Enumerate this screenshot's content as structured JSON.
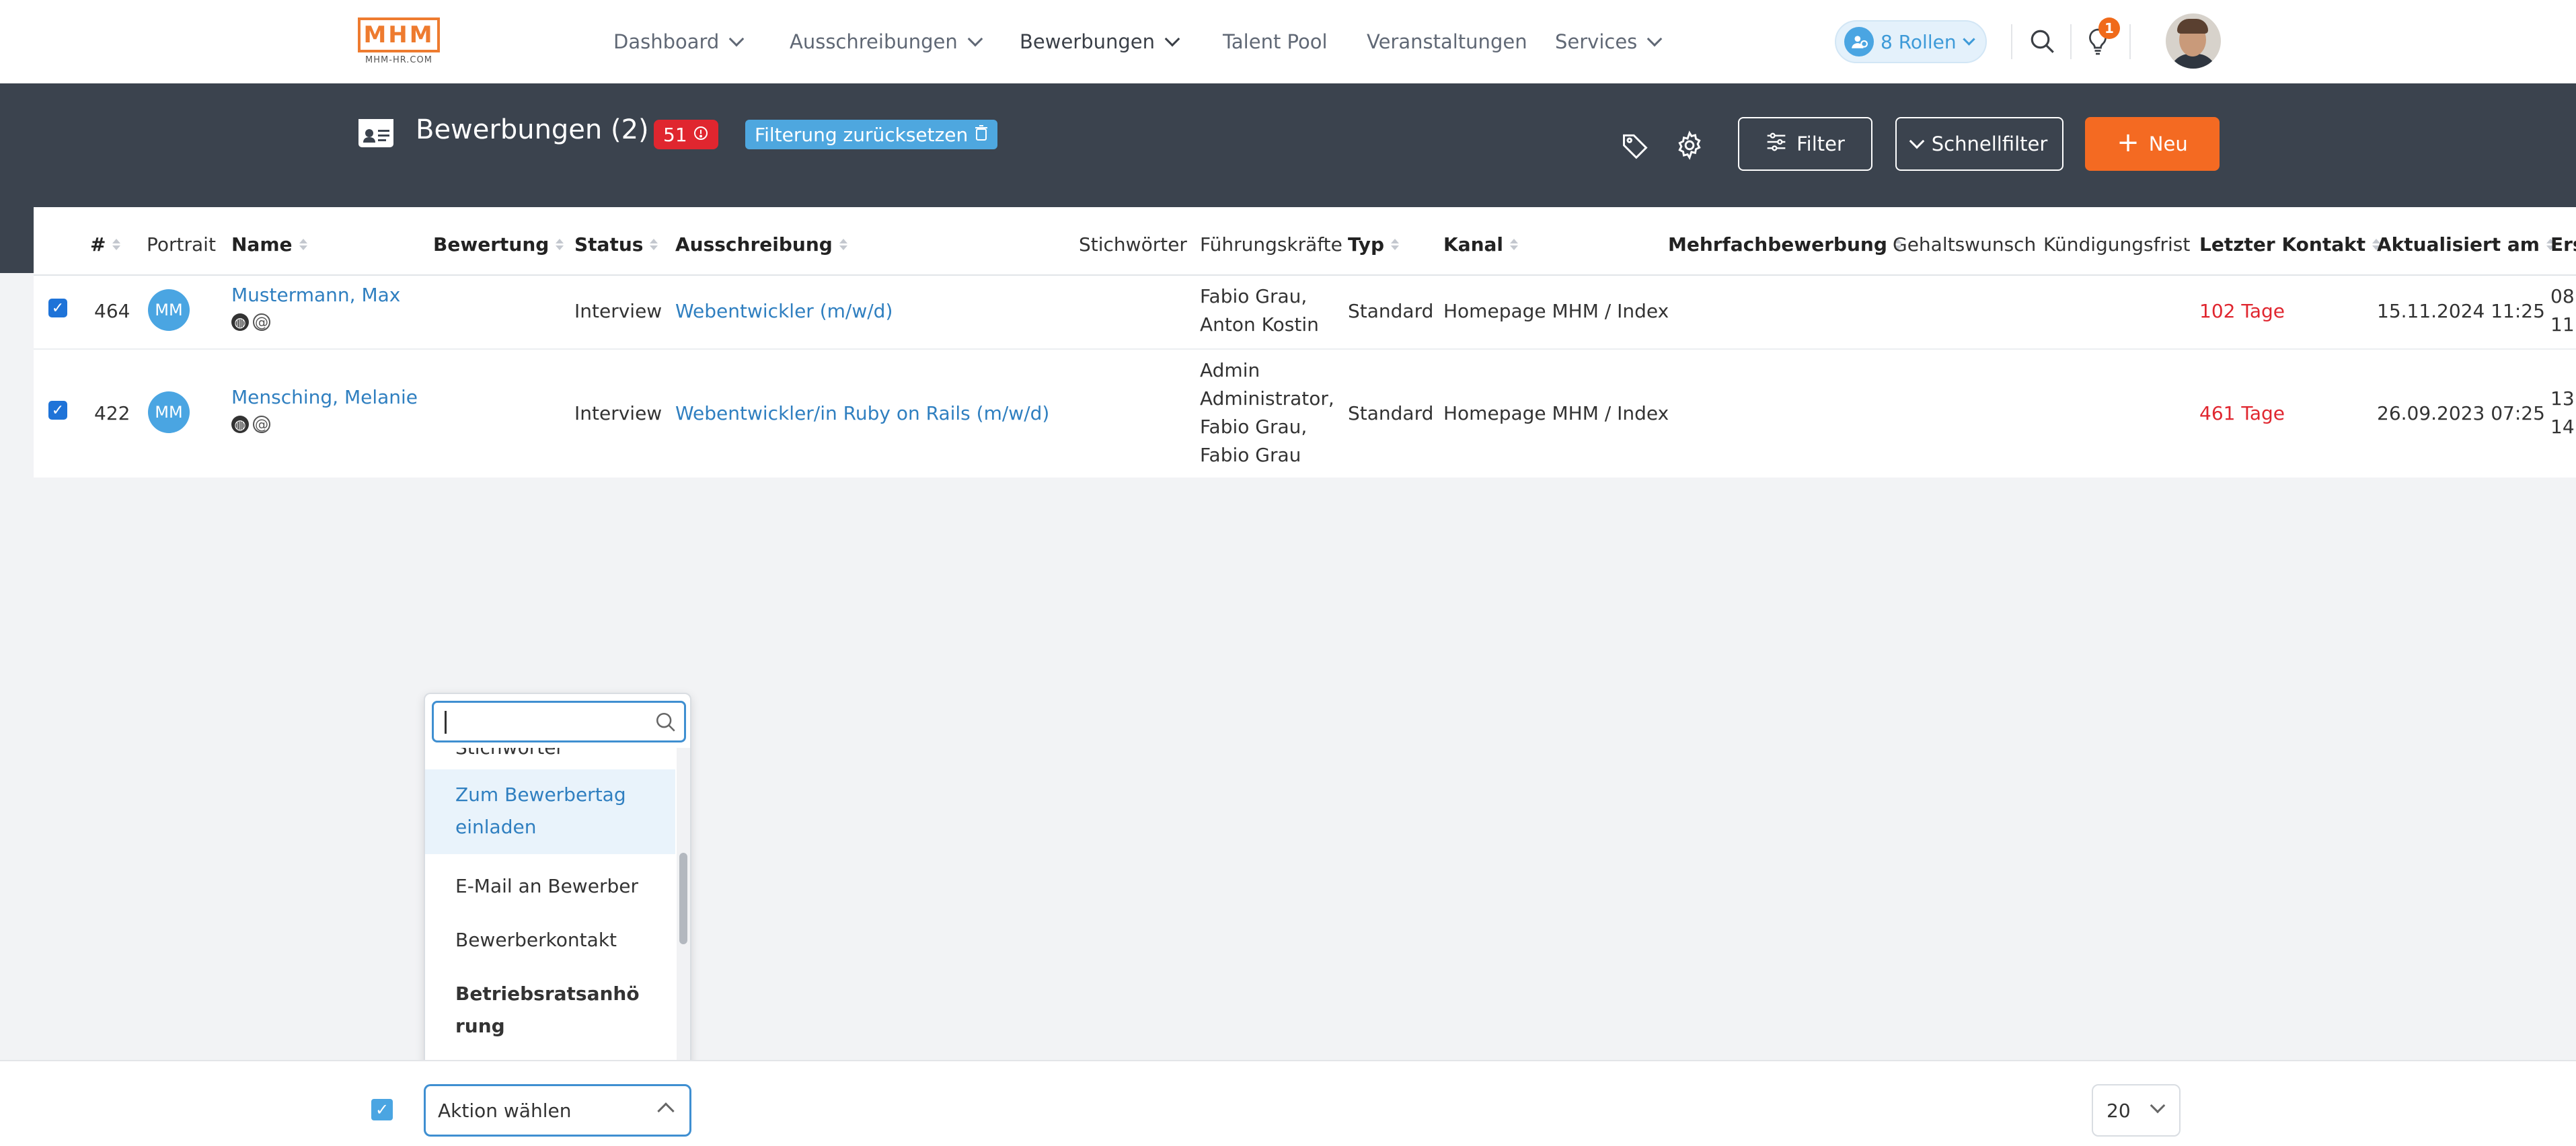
{
  "app": {
    "logo_text": "MHM",
    "logo_sub": "MHM-HR.COM"
  },
  "nav": {
    "items": [
      {
        "label": "Dashboard",
        "dropdown": true
      },
      {
        "label": "Ausschreibungen",
        "dropdown": true
      },
      {
        "label": "Bewerbungen",
        "dropdown": true
      },
      {
        "label": "Talent Pool",
        "dropdown": false
      },
      {
        "label": "Veranstaltungen",
        "dropdown": false
      },
      {
        "label": "Services",
        "dropdown": true
      }
    ],
    "roles_label": "8 Rollen",
    "notification_count": "1",
    "icons": [
      "search-icon",
      "lightbulb-icon",
      "user-avatar"
    ]
  },
  "header": {
    "title": "Bewerbungen (2)",
    "count_badge": "51",
    "reset_filter": "Filterung zurücksetzen",
    "filter_button": "Filter",
    "quickfilter_button": "Schnellfilter",
    "new_button": "Neu",
    "colors": {
      "background": "#3b434e",
      "accent": "#f46a22",
      "danger": "#e0262f",
      "info": "#4ea7df"
    }
  },
  "table": {
    "columns": [
      "#",
      "Portrait",
      "Name",
      "Bewertung",
      "Status",
      "Ausschreibung",
      "Stichwörter",
      "Führungskräfte",
      "Typ",
      "Kanal",
      "Mehrfachbewerbung",
      "Gehaltswunsch",
      "Kündigungsfrist",
      "Letzter Kontakt",
      "Aktualisiert am",
      "Ers"
    ],
    "rows": [
      {
        "checked": true,
        "id": "464",
        "initials": "MM",
        "name": "Mustermann, Max",
        "status": "Interview",
        "job": "Webentwickler (m/w/d)",
        "managers": [
          "Fabio Grau,",
          "Anton Kostin"
        ],
        "type": "Standard",
        "channel": "Homepage MHM / Index",
        "last_contact": "102 Tage",
        "updated": "15.11.2024 11:25",
        "created": [
          "08",
          "11"
        ]
      },
      {
        "checked": true,
        "id": "422",
        "initials": "MM",
        "name": "Mensching, Melanie",
        "status": "Interview",
        "job": "Webentwickler/in Ruby on Rails (m/w/d)",
        "managers": [
          "Admin",
          "Administrator,",
          "Fabio Grau,",
          "Fabio Grau"
        ],
        "type": "Standard",
        "channel": "Homepage MHM / Index",
        "last_contact": "461 Tage",
        "updated": "26.09.2023 07:25",
        "created": [
          "13",
          "14"
        ]
      }
    ]
  },
  "action_dropdown": {
    "search_placeholder": "",
    "items": [
      {
        "label": "Stichwörter vergeben"
      },
      {
        "label": "Zum Bewerbertag einladen"
      },
      {
        "label": "E-Mail an Bewerber"
      },
      {
        "label": "Bewerberkontakt"
      },
      {
        "label": "Betriebsratsanhörung"
      }
    ]
  },
  "footer": {
    "action_select": "Aktion wählen",
    "page_size": "20"
  }
}
